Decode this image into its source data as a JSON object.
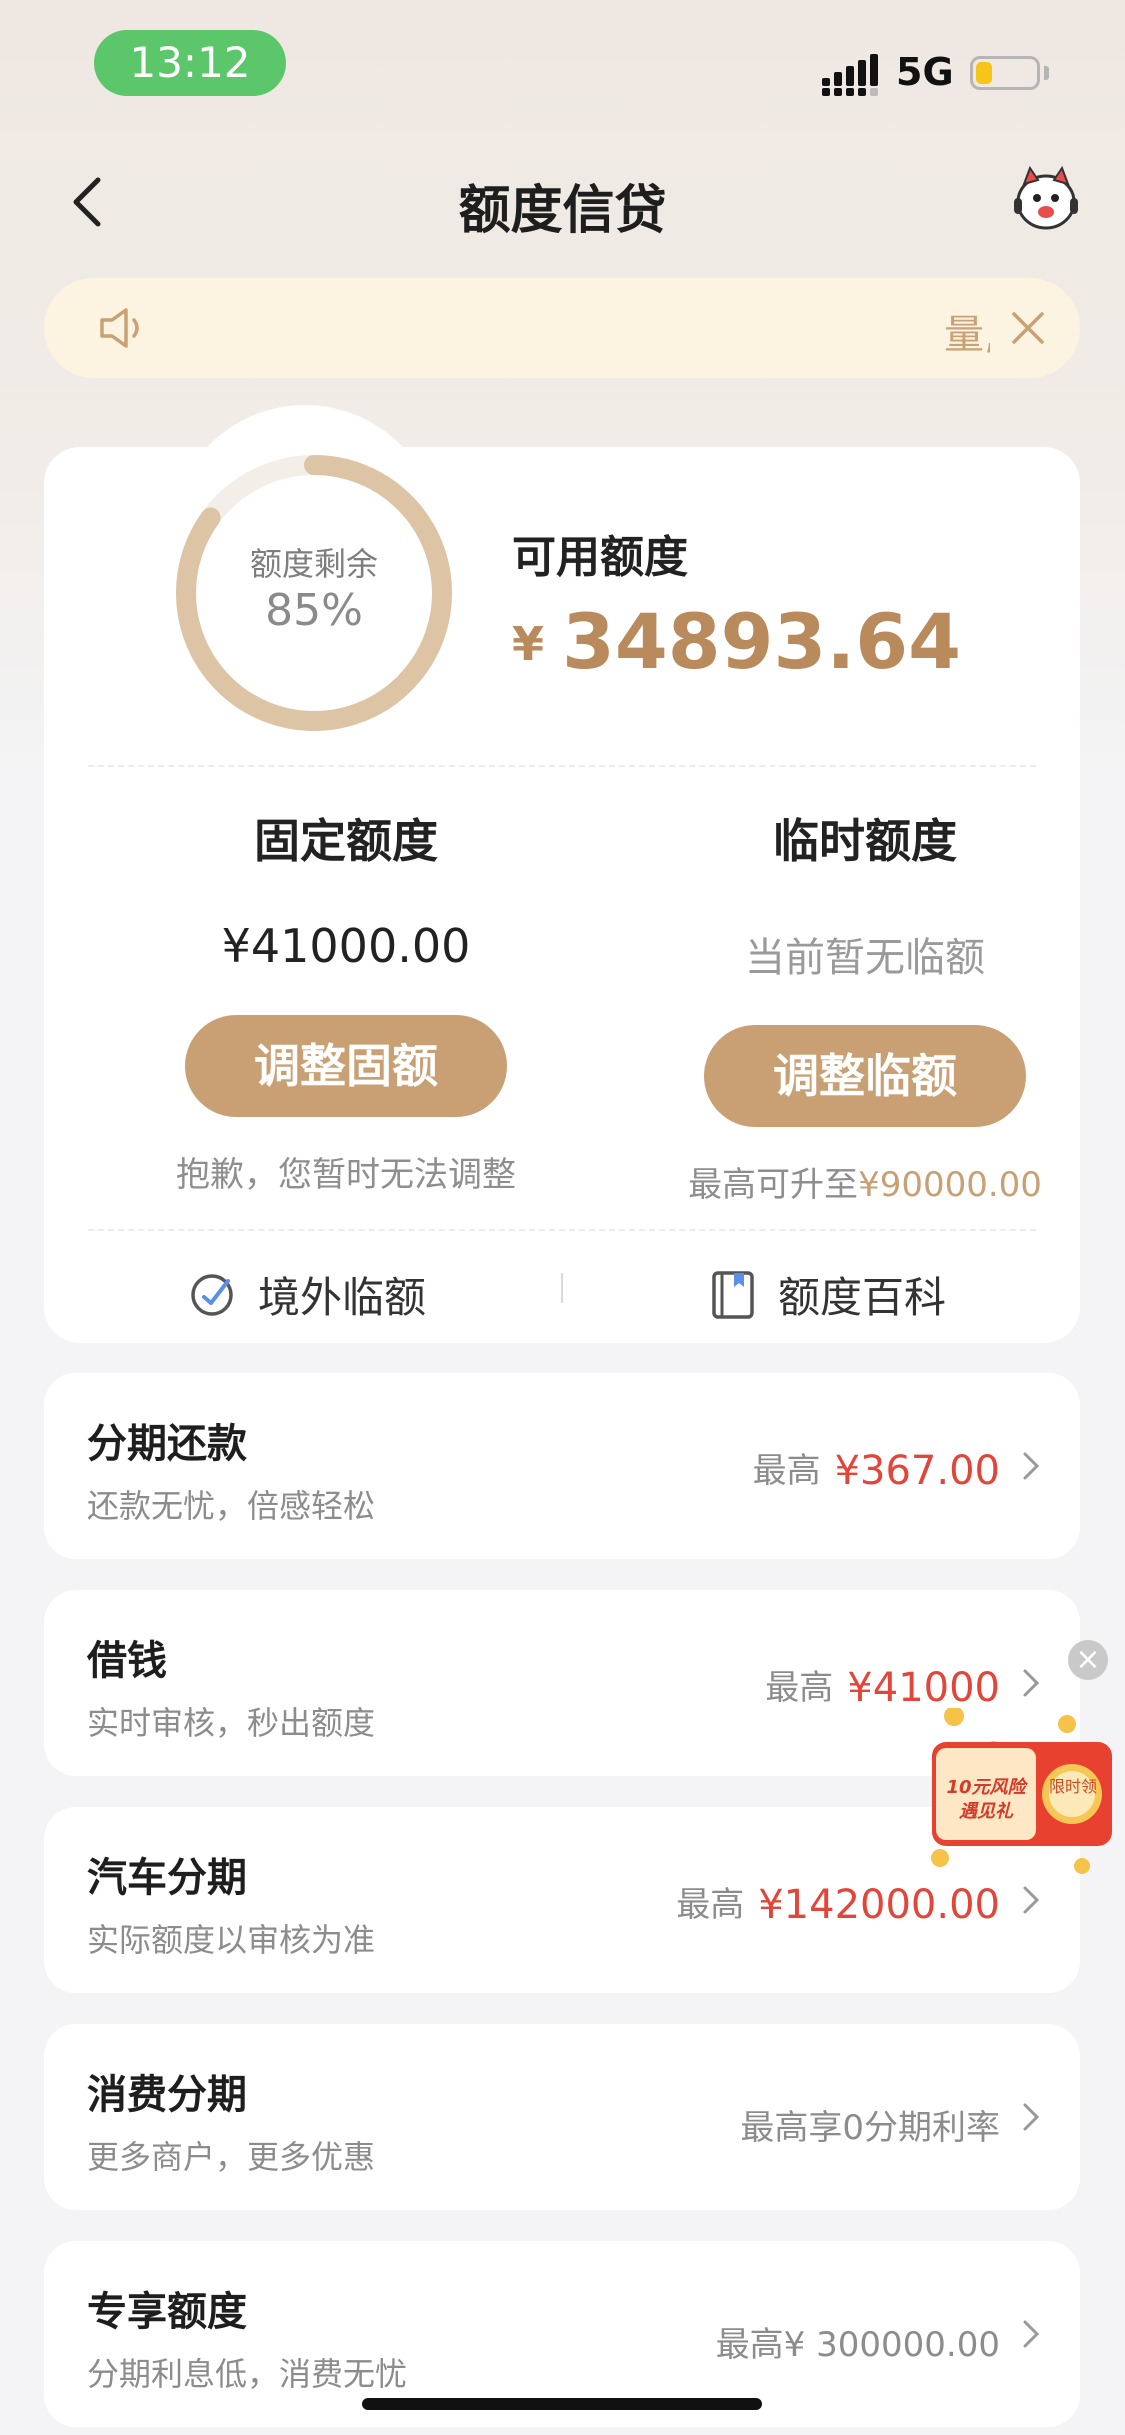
{
  "status_bar": {
    "time": "13:12",
    "network": "5G",
    "battery_level": 0.28
  },
  "nav": {
    "title": "额度信贷"
  },
  "notice": {
    "text": "量,"
  },
  "summary": {
    "ring_label": "额度剩余",
    "ring_percent": "85%",
    "ring_value": 0.85,
    "available_label": "可用额度",
    "available_currency": "¥",
    "available_amount": "34893.64"
  },
  "fixed": {
    "title": "固定额度",
    "value": "¥41000.00",
    "button": "调整固额",
    "note": "抱歉，您暂时无法调整"
  },
  "temporary": {
    "title": "临时额度",
    "value": "当前暂无临额",
    "button": "调整临额",
    "note_prefix": "最高可升至",
    "note_amount": "¥90000.00"
  },
  "tools": {
    "overseas": "境外临额",
    "encyclopedia": "额度百科"
  },
  "services": [
    {
      "title": "分期还款",
      "subtitle": "还款无忧，倍感轻松",
      "prefix": "最高",
      "amount": "¥367.00"
    },
    {
      "title": "借钱",
      "subtitle": "实时审核，秒出额度",
      "prefix": "最高",
      "amount": "¥41000"
    },
    {
      "title": "汽车分期",
      "subtitle": "实际额度以审核为准",
      "prefix": "最高",
      "amount": "¥142000.00"
    },
    {
      "title": "消费分期",
      "subtitle": "更多商户，更多优惠",
      "prefix": "最高享0分期利率",
      "amount": ""
    },
    {
      "title": "专享额度",
      "subtitle": "分期利息低，消费无忧",
      "prefix": "最高¥ 300000.00",
      "amount": ""
    }
  ],
  "promo": {
    "text": "10元风险 遇见礼",
    "badge": "限时领",
    "close": "×"
  },
  "colors": {
    "accent_gold": "#c8a074",
    "amount_red": "#e2463a",
    "notice_bg": "#fdf3e1"
  }
}
